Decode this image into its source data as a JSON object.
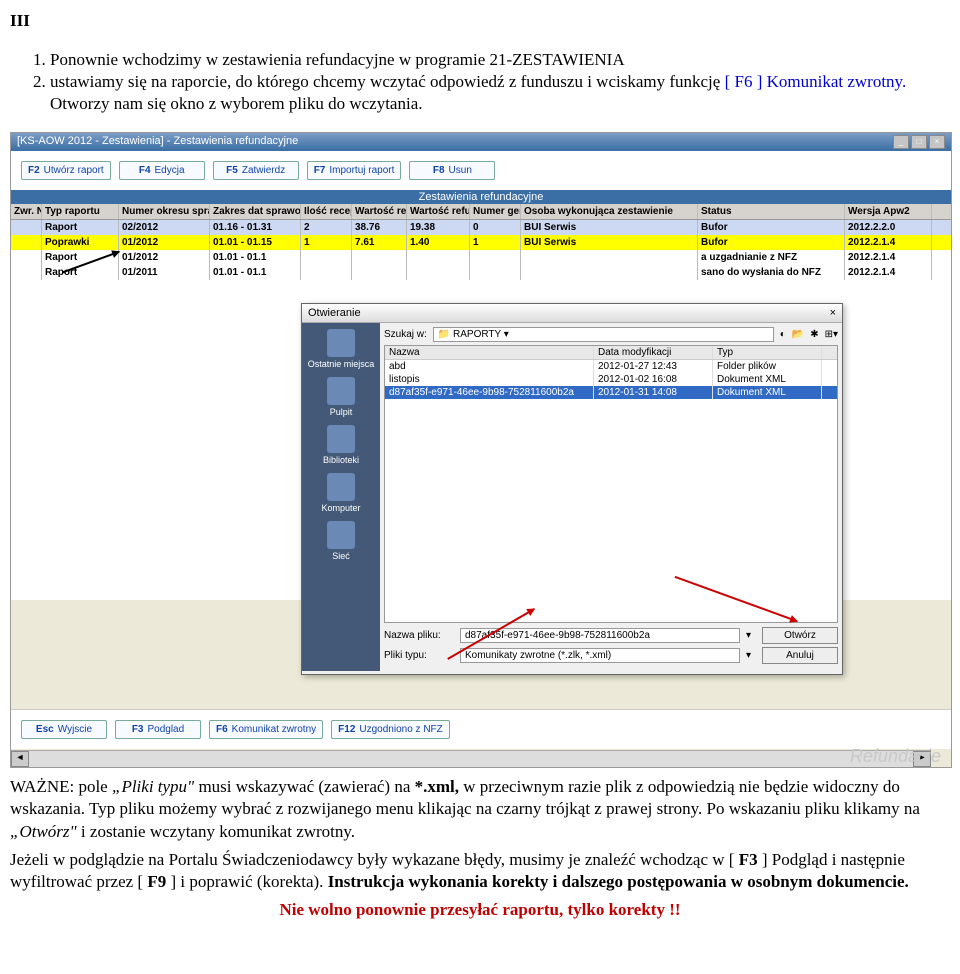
{
  "doc": {
    "section": "III",
    "item1": "Ponownie wchodzimy w zestawienia refundacyjne w programie 21-ZESTAWIENIA",
    "item2_a": "ustawiamy się na raporcie, do którego chcemy wczytać odpowiedź z funduszu i wciskamy funkcję",
    "item2_key": "[ F6 ] Komunikat zwrotny.",
    "item2_b": "Otworzy nam się okno z wyborem pliku do wczytania."
  },
  "app": {
    "title": "[KS-AOW 2012 - Zestawienia] - Zestawienia refundacyjne",
    "panel": "Zestawienia refundacyjne",
    "watermark": "Refundacje",
    "buttons_top": [
      {
        "key": "F2",
        "label": "Utwórz raport"
      },
      {
        "key": "F4",
        "label": "Edycja"
      },
      {
        "key": "F5",
        "label": "Zatwierdz"
      },
      {
        "key": "F7",
        "label": "Importuj raport"
      },
      {
        "key": "F8",
        "label": "Usun"
      }
    ],
    "buttons_bottom": [
      {
        "key": "Esc",
        "label": "Wyjscie"
      },
      {
        "key": "F3",
        "label": "Podglad"
      },
      {
        "key": "F6",
        "label": "Komunikat zwrotny"
      },
      {
        "key": "F12",
        "label": "Uzgodniono z NFZ"
      }
    ],
    "headers": {
      "zwr": "Zwr. NFZ",
      "typ": "Typ raportu",
      "num": "Numer okresu sprawozdania",
      "zak": "Zakres dat sprawozdania",
      "il": "Ilość recept",
      "war": "Wartość recept",
      "war2": "Wartość refundacji",
      "gen": "Numer generacji",
      "oso": "Osoba wykonująca zestawienie",
      "stat": "Status",
      "wer": "Wersja Apw2"
    },
    "rows": [
      {
        "typ": "Raport",
        "num": "02/2012",
        "zak": "01.16 - 01.31",
        "il": "2",
        "war": "38.76",
        "war2": "19.38",
        "gen": "0",
        "oso": "BUI Serwis",
        "stat": "Bufor",
        "wer": "2012.2.2.0",
        "cls": "sel"
      },
      {
        "typ": "Poprawki",
        "num": "01/2012",
        "zak": "01.01 - 01.15",
        "il": "1",
        "war": "7.61",
        "war2": "1.40",
        "gen": "1",
        "oso": "BUI Serwis",
        "stat": "Bufor",
        "wer": "2012.2.1.4",
        "cls": "yellow"
      },
      {
        "typ": "Raport",
        "num": "01/2012",
        "zak": "01.01 - 01.1",
        "il": "",
        "war": "",
        "war2": "",
        "gen": "",
        "oso": "",
        "stat": "a uzgadnianie z NFZ",
        "wer": "2012.2.1.4",
        "cls": ""
      },
      {
        "typ": "Raport",
        "num": "01/2011",
        "zak": "01.01 - 01.1",
        "il": "",
        "war": "",
        "war2": "",
        "gen": "",
        "oso": "",
        "stat": "sano do wysłania do NFZ",
        "wer": "2012.2.1.4",
        "cls": ""
      }
    ]
  },
  "dialog": {
    "title": "Otwieranie",
    "lookin_lbl": "Szukaj w:",
    "lookin_val": "RAPORTY",
    "sidebar": [
      "Ostatnie miejsca",
      "Pulpit",
      "Biblioteki",
      "Komputer",
      "Sieć"
    ],
    "file_headers": {
      "name": "Nazwa",
      "date": "Data modyfikacji",
      "type": "Typ"
    },
    "files": [
      {
        "name": "abd",
        "date": "2012-01-27 12:43",
        "type": "Folder plików",
        "sel": false
      },
      {
        "name": "listopis",
        "date": "2012-01-02 16:08",
        "type": "Dokument XML",
        "sel": false
      },
      {
        "name": "d87af35f-e971-46ee-9b98-752811600b2a",
        "date": "2012-01-31 14:08",
        "type": "Dokument XML",
        "sel": true
      }
    ],
    "filename_lbl": "Nazwa pliku:",
    "filename_val": "d87af35f-e971-46ee-9b98-752811600b2a",
    "filetype_lbl": "Pliki typu:",
    "filetype_val": "Komunikaty zwrotne (*.zlk, *.xml)",
    "open_btn": "Otwórz",
    "cancel_btn": "Anuluj"
  },
  "note": {
    "p1_a": "WAŻNE: pole ",
    "p1_i1": "„Pliki  typu\"",
    "p1_b": " musi wskazywać (zawierać) na ",
    "p1_bold": "*.xml, ",
    "p1_c": "w przeciwnym razie plik z odpowiedzią nie będzie widoczny do wskazania. Typ pliku możemy wybrać z rozwijanego menu klikając na czarny trójkąt z prawej strony. Po wskazaniu pliku klikamy na ",
    "p1_i2": "„Otwórz\"",
    "p1_d": " i zostanie wczytany komunikat zwrotny.",
    "p2_a": "Jeżeli w podglądzie na Portalu Świadczeniodawcy były wykazane błędy, musimy je znaleźć wchodząc w [ ",
    "p2_k1": "F3",
    "p2_b": " ] Podgląd i następnie wyfiltrować przez [ ",
    "p2_k2": "F9",
    "p2_c": " ] i poprawić (korekta). ",
    "p2_bold": "Instrukcja wykonania korekty i dalszego postępowania w osobnym dokumencie.",
    "p3": "Nie wolno ponownie przesyłać raportu, tylko korekty !!"
  }
}
